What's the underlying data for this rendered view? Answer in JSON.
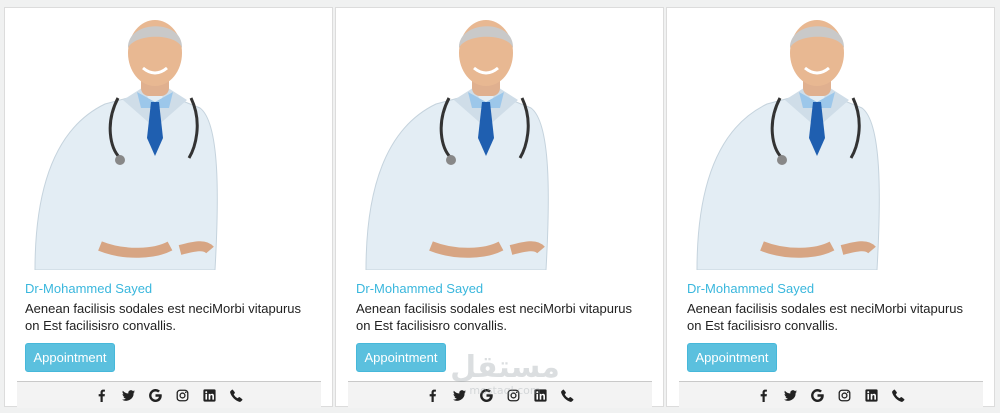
{
  "cards": [
    {
      "name": "Dr-Mohammed Sayed",
      "description": "Aenean facilisis sodales est neciMorbi vitapurus on Est facilisisro convallis.",
      "button_label": "Appointment",
      "social_icons": [
        "facebook-icon",
        "twitter-icon",
        "google-icon",
        "instagram-icon",
        "linkedin-icon",
        "phone-icon"
      ]
    },
    {
      "name": "Dr-Mohammed Sayed",
      "description": "Aenean facilisis sodales est neciMorbi vitapurus on Est facilisisro convallis.",
      "button_label": "Appointment",
      "social_icons": [
        "facebook-icon",
        "twitter-icon",
        "google-icon",
        "instagram-icon",
        "linkedin-icon",
        "phone-icon"
      ]
    },
    {
      "name": "Dr-Mohammed Sayed",
      "description": "Aenean facilisis sodales est neciMorbi vitapurus on Est facilisisro convallis.",
      "button_label": "Appointment",
      "social_icons": [
        "facebook-icon",
        "twitter-icon",
        "google-icon",
        "instagram-icon",
        "linkedin-icon",
        "phone-icon"
      ]
    }
  ],
  "colors": {
    "name_accent": "#3ab7dd",
    "button_bg": "#5bc0de",
    "page_bg": "#f0f1f1"
  },
  "watermark": {
    "main": "مستقل",
    "sub": "mostaql.com"
  }
}
